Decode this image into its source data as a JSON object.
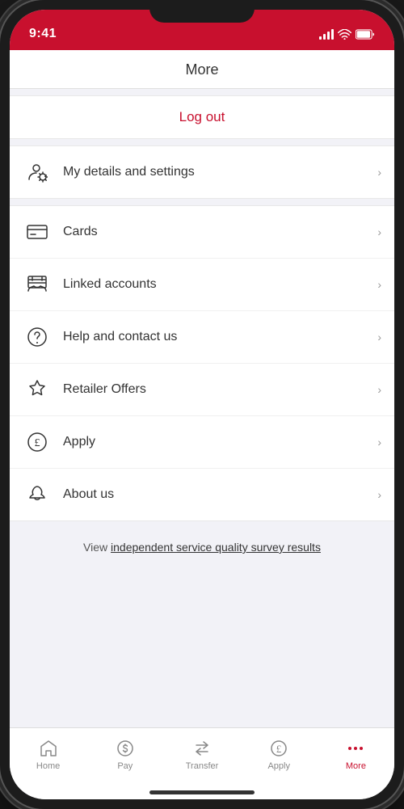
{
  "status_bar": {
    "time": "9:41",
    "signal_alt": "signal bars",
    "wifi_alt": "wifi",
    "battery_alt": "battery"
  },
  "header": {
    "title": "More"
  },
  "logout": {
    "label": "Log out"
  },
  "menu": {
    "my_details": {
      "label": "My details and settings",
      "icon": "person-settings-icon"
    },
    "items": [
      {
        "label": "Cards",
        "icon": "cards-icon"
      },
      {
        "label": "Linked accounts",
        "icon": "linked-accounts-icon"
      },
      {
        "label": "Help and contact us",
        "icon": "help-icon"
      },
      {
        "label": "Retailer Offers",
        "icon": "retailer-offers-icon"
      },
      {
        "label": "Apply",
        "icon": "apply-icon"
      },
      {
        "label": "About us",
        "icon": "about-us-icon"
      }
    ]
  },
  "survey": {
    "prefix": "View ",
    "link_text": "independent service quality survey results"
  },
  "tab_bar": {
    "items": [
      {
        "label": "Home",
        "icon": "home-icon",
        "active": false
      },
      {
        "label": "Pay",
        "icon": "pay-icon",
        "active": false
      },
      {
        "label": "Transfer",
        "icon": "transfer-icon",
        "active": false
      },
      {
        "label": "Apply",
        "icon": "apply-tab-icon",
        "active": false
      },
      {
        "label": "More",
        "icon": "more-icon",
        "active": true
      }
    ]
  }
}
